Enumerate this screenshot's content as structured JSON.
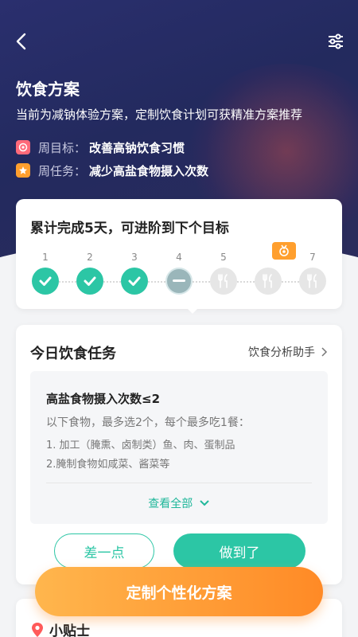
{
  "header": {
    "title": "饮食方案",
    "subtitle": "当前为减钠体验方案，定制饮食计划可获精准方案推荐",
    "weekly_goal_label": "周目标：",
    "weekly_goal_value": "改善高钠饮食习惯",
    "weekly_task_label": "周任务：",
    "weekly_task_value": "减少高盐食物摄入次数"
  },
  "progress": {
    "title": "累计完成5天，可进阶到下个目标",
    "days": [
      {
        "num": "1",
        "state": "done"
      },
      {
        "num": "2",
        "state": "done"
      },
      {
        "num": "3",
        "state": "done"
      },
      {
        "num": "4",
        "state": "current"
      },
      {
        "num": "5",
        "state": "future"
      },
      {
        "num": "",
        "state": "future"
      },
      {
        "num": "7",
        "state": "future"
      }
    ]
  },
  "task": {
    "title": "今日饮食任务",
    "assistant_link": "饮食分析助手",
    "heading": "高盐食物摄入次数≤2",
    "description": "以下食物，最多选2个，每个最多吃1餐：",
    "items": [
      "1. 加工（腌熏、卤制类）鱼、肉、蛋制品",
      "2.腌制食物如咸菜、酱菜等"
    ],
    "see_all": "查看全部",
    "btn_almost": "差一点",
    "btn_done": "做到了"
  },
  "tips": {
    "title": "小贴士"
  },
  "cta": {
    "label": "定制个性化方案"
  },
  "colors": {
    "accent": "#2cc6a5",
    "cta_start": "#ffb64d",
    "cta_end": "#ff8a26",
    "hero": "#232a5e"
  }
}
